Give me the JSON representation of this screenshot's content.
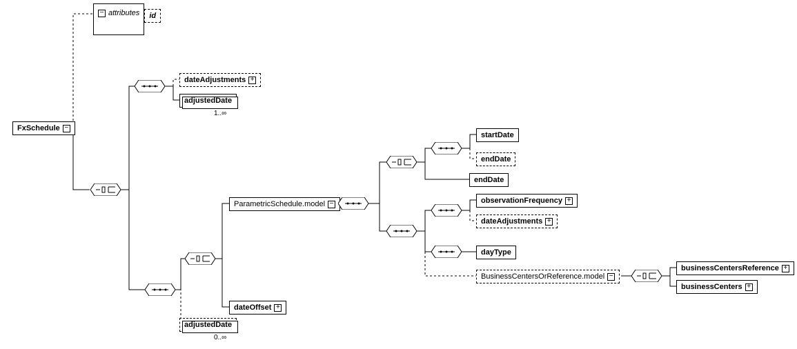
{
  "root": "FxSchedule",
  "attributes_label": "attributes",
  "id_label": "id",
  "dateAdjustments": "dateAdjustments",
  "adjustedDate": "adjustedDate",
  "adjustedDate_card": "1..∞",
  "parametricSchedule": "ParametricSchedule.model",
  "dateOffset": "dateOffset",
  "adjustedDate2": "adjustedDate",
  "adjustedDate2_card": "0..∞",
  "startDate": "startDate",
  "endDate_opt": "endDate",
  "endDate": "endDate",
  "observationFrequency": "observationFrequency",
  "dateAdjustments2": "dateAdjustments",
  "dayType": "dayType",
  "bizCentersModel": "BusinessCentersOrReference.model",
  "businessCentersReference": "businessCentersReference",
  "businessCenters": "businessCenters"
}
